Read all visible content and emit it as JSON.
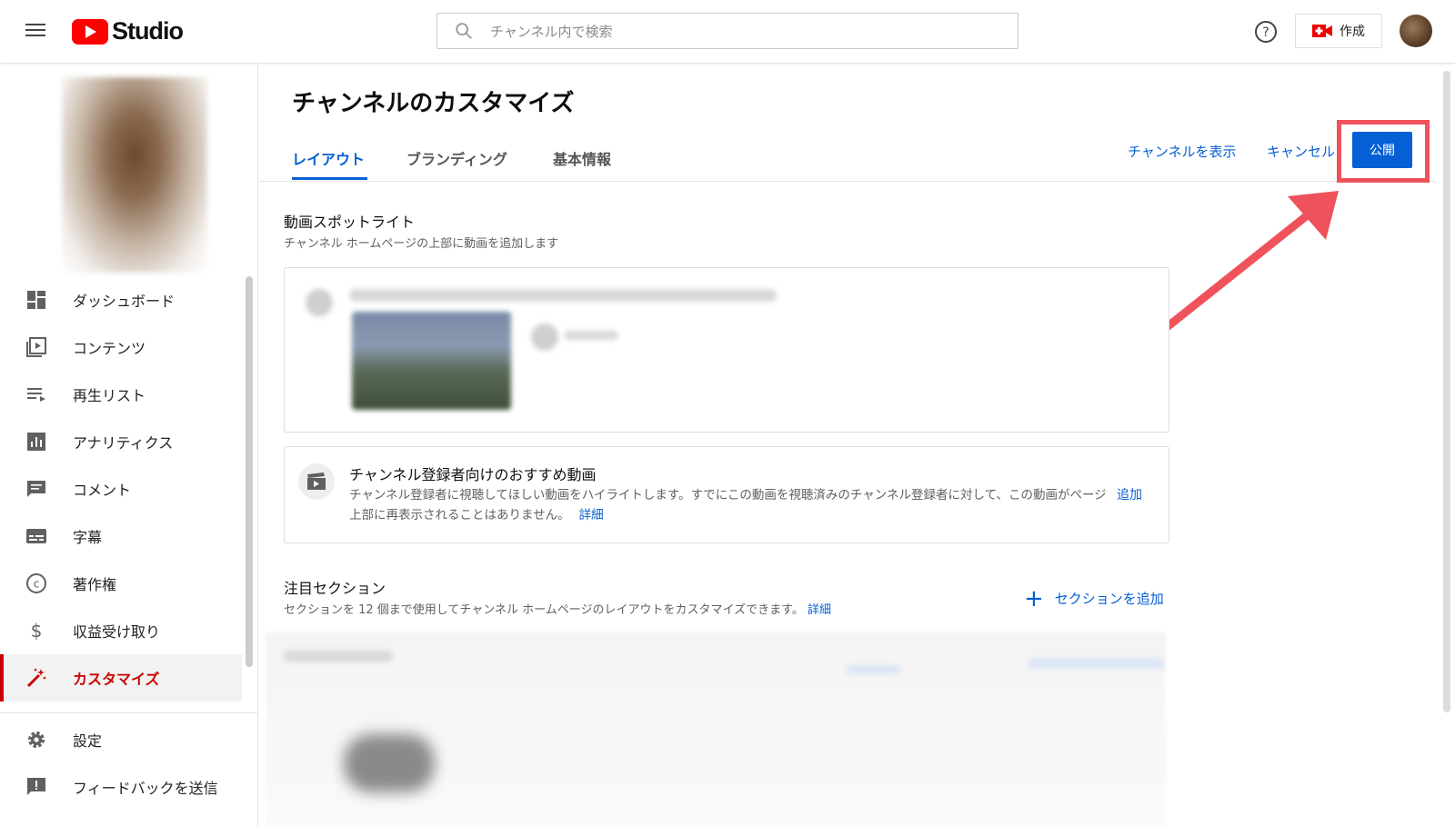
{
  "header": {
    "app_name": "Studio",
    "search_placeholder": "チャンネル内で検索",
    "create_label": "作成"
  },
  "sidebar": {
    "items": [
      {
        "label": "ダッシュボード",
        "icon": "dashboard-icon"
      },
      {
        "label": "コンテンツ",
        "icon": "content-icon"
      },
      {
        "label": "再生リスト",
        "icon": "playlist-icon"
      },
      {
        "label": "アナリティクス",
        "icon": "analytics-icon"
      },
      {
        "label": "コメント",
        "icon": "comment-icon"
      },
      {
        "label": "字幕",
        "icon": "subtitles-icon"
      },
      {
        "label": "著作権",
        "icon": "copyright-icon"
      },
      {
        "label": "収益受け取り",
        "icon": "dollar-icon"
      },
      {
        "label": "カスタマイズ",
        "icon": "magic-wand-icon",
        "active": true
      }
    ],
    "bottom_items": [
      {
        "label": "設定",
        "icon": "gear-icon"
      },
      {
        "label": "フィードバックを送信",
        "icon": "feedback-icon"
      }
    ]
  },
  "main": {
    "title": "チャンネルのカスタマイズ",
    "tabs": [
      {
        "label": "レイアウト",
        "active": true
      },
      {
        "label": "ブランディング"
      },
      {
        "label": "基本情報"
      }
    ],
    "view_channel": "チャンネルを表示",
    "cancel": "キャンセル",
    "publish": "公開",
    "spotlight": {
      "title": "動画スポットライト",
      "subtitle": "チャンネル ホームページの上部に動画を追加します"
    },
    "recommended": {
      "title": "チャンネル登録者向けのおすすめ動画",
      "desc": "チャンネル登録者に視聴してほしい動画をハイライトします。すでにこの動画を視聴済みのチャンネル登録者に対して、この動画がページ上部に再表示されることはありません。",
      "details_link": "詳細",
      "add": "追加"
    },
    "featured": {
      "title": "注目セクション",
      "subtitle": "セクションを 12 個まで使用してチャンネル ホームページのレイアウトをカスタマイズできます。",
      "details_link": "詳細",
      "add_section": "セクションを追加"
    }
  },
  "colors": {
    "accent": "#065fd4",
    "active_nav": "#cc0000",
    "annotation": "#f0525c"
  }
}
